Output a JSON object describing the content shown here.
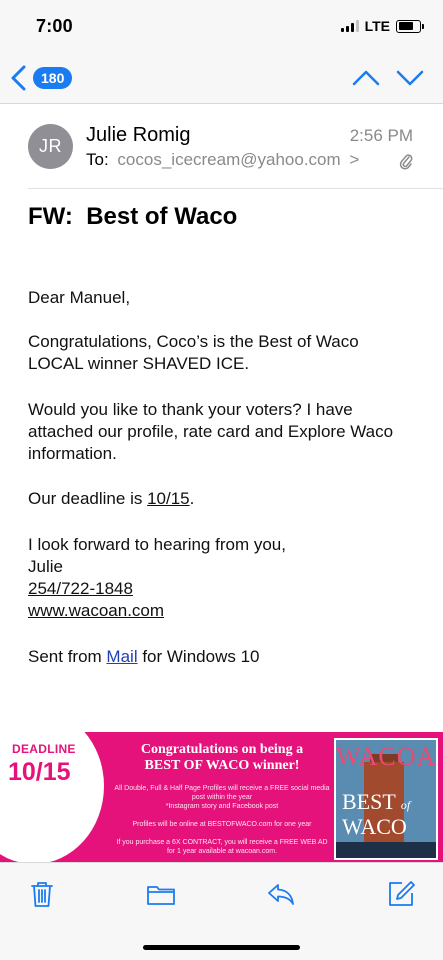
{
  "status_bar": {
    "time": "7:00",
    "network": "LTE"
  },
  "nav": {
    "back_count": "180",
    "accent_color": "#1a7cf0",
    "icons": [
      "chevron-left-icon",
      "chevron-up-icon",
      "chevron-down-icon"
    ]
  },
  "email": {
    "avatar_initials": "JR",
    "sender": "Julie Romig",
    "time": "2:56 PM",
    "to_label": "To:",
    "to_address": "cocos_icecream@yahoo.com",
    "to_chevron": ">",
    "subject": "FW:  Best of Waco"
  },
  "body": {
    "greeting": "Dear Manuel,",
    "para1_line1": "Congratulations, Coco’s is the Best of Waco",
    "para1_line2": "LOCAL winner SHAVED ICE.",
    "para2_line1": "Would you like to thank your voters? I have",
    "para2_line2": "attached our profile, rate card and Explore Waco",
    "para2_line3": "information.",
    "deadline_prefix": "Our deadline is ",
    "deadline_date": "10/15",
    "deadline_suffix": ".",
    "closing": "I look forward to hearing from you,",
    "signature_name": "Julie",
    "phone": "254/722-1848",
    "website": "www.wacoan.com",
    "sent_prefix": "Sent from ",
    "sent_link": "Mail",
    "sent_suffix": " for Windows 10"
  },
  "banner": {
    "deadline_label": "DEADLINE",
    "deadline_date": "10/15",
    "headline_line1": "Congratulations on being a",
    "headline_line2": "BEST OF WACO winner!",
    "fine1_line1": "All Double, Full & Half Page Profiles will receive a FREE social media",
    "fine1_line2": "post within the year",
    "fine1_line3": "*Instagram story and Facebook post",
    "fine2": "Profiles will be online at BESTOFWACO.com for one year",
    "fine3_line1": "If you purchase a 6X CONTRACT, you will receive a FREE WEB AD",
    "fine3_line2": "for 1 year available at wacoan.com.",
    "magazine_title": "WACOAN",
    "magazine_best": "BEST",
    "magazine_of": "of",
    "magazine_waco": "WACO",
    "brand_color": "#e5127c"
  },
  "toolbar": {
    "icons": [
      "trash-icon",
      "folder-icon",
      "reply-icon",
      "compose-icon"
    ]
  }
}
